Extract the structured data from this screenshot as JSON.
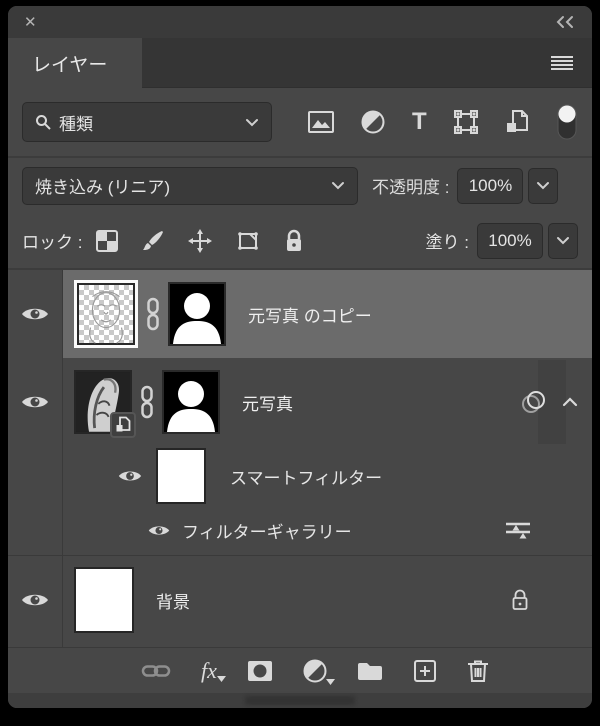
{
  "window": {
    "close_label": "✕"
  },
  "tab": {
    "label": "レイヤー"
  },
  "filter_bar": {
    "kind_value": "種類",
    "filter_toggle_on": true
  },
  "blend_row": {
    "blend_mode": "焼き込み (リニア)",
    "opacity_label": "不透明度 :",
    "opacity_value": "100%"
  },
  "lock_row": {
    "label": "ロック :",
    "fill_label": "塗り :",
    "fill_value": "100%"
  },
  "layers": {
    "copy": {
      "name": "元写真 のコピー",
      "selected": true,
      "has_mask": true,
      "linked": true
    },
    "original": {
      "name": "元写真",
      "selected": false,
      "has_mask": true,
      "linked": true,
      "smart_object": true,
      "smart_filters_expanded": true
    },
    "smart_filter": {
      "label": "スマートフィルター",
      "visible": true
    },
    "filter_gallery": {
      "label": "フィルターギャラリー",
      "visible": true
    },
    "background": {
      "name": "背景",
      "locked": true
    }
  },
  "bottom_bar": {
    "fx_label": "fx"
  },
  "colors": {
    "panel_bg": "#474747",
    "titlebar_bg": "#3a3a3a",
    "tabstrip_bg": "#353535",
    "control_bg": "#3a3a3a",
    "selected_row_bg": "#6b6b6b",
    "icon_color": "#d9d9d9",
    "text_color": "#e6e6e6"
  }
}
